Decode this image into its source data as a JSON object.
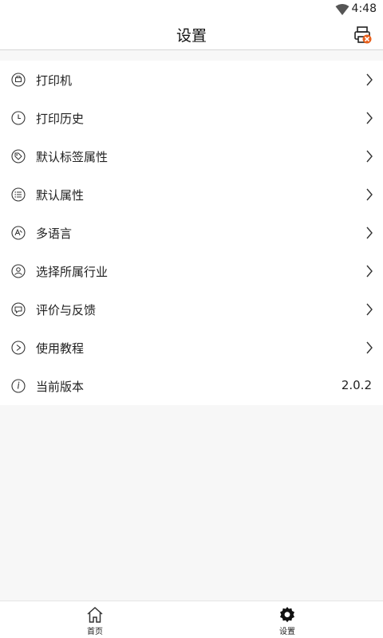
{
  "status_bar": {
    "time": "4:48",
    "icons": [
      "wifi-icon"
    ]
  },
  "header": {
    "title": "设置",
    "right_icon": "printer-error-icon",
    "accent": "#e8601c"
  },
  "menu": {
    "items": [
      {
        "icon": "printer-globe-icon",
        "label": "打印机"
      },
      {
        "icon": "clock-icon",
        "label": "打印历史"
      },
      {
        "icon": "tag-icon",
        "label": "默认标签属性"
      },
      {
        "icon": "list-icon",
        "label": "默认属性"
      },
      {
        "icon": "language-icon",
        "label": "多语言"
      },
      {
        "icon": "industry-icon",
        "label": "选择所属行业"
      },
      {
        "icon": "feedback-icon",
        "label": "评价与反馈"
      },
      {
        "icon": "tutorial-icon",
        "label": "使用教程"
      }
    ],
    "version": {
      "icon": "info-icon",
      "label": "当前版本",
      "value": "2.0.2"
    }
  },
  "tabbar": {
    "home": {
      "icon": "home-icon",
      "label": "首页"
    },
    "settings": {
      "icon": "gear-icon",
      "label": "设置"
    }
  }
}
